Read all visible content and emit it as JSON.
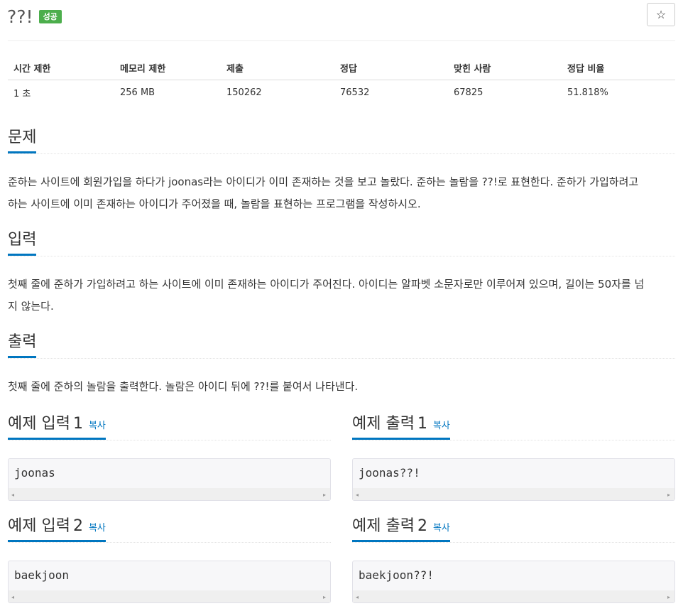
{
  "header": {
    "title": "??!",
    "badge": "성공",
    "star": "☆"
  },
  "info_table": {
    "headers": [
      "시간 제한",
      "메모리 제한",
      "제출",
      "정답",
      "맞힌 사람",
      "정답 비율"
    ],
    "values": [
      "1 초",
      "256 MB",
      "150262",
      "76532",
      "67825",
      "51.818%"
    ]
  },
  "problem": {
    "title": "문제",
    "lines": [
      "준하는 사이트에 회원가입을 하다가 joonas라는 아이디가 이미 존재하는 것을 보고 놀랐다. 준하는 놀람을 ??!로 표현한다. 준하가 가입하려고",
      "하는 사이트에 이미 존재하는 아이디가 주어졌을 때, 놀람을 표현하는 프로그램을 작성하시오."
    ]
  },
  "input": {
    "title": "입력",
    "lines": [
      "첫째 줄에 준하가 가입하려고 하는 사이트에 이미 존재하는 아이디가 주어진다. 아이디는 알파벳 소문자로만 이루어져 있으며, 길이는 50자를 넘",
      "지 않는다."
    ]
  },
  "output": {
    "title": "출력",
    "lines": [
      "첫째 줄에 준하의 놀람을 출력한다. 놀람은 아이디 뒤에 ??!를 붙여서 나타낸다."
    ]
  },
  "samples": [
    {
      "label": "예제 입력",
      "num": "1",
      "copy": "복사",
      "code": "joonas"
    },
    {
      "label": "예제 출력",
      "num": "1",
      "copy": "복사",
      "code": "joonas??!"
    },
    {
      "label": "예제 입력",
      "num": "2",
      "copy": "복사",
      "code": "baekjoon"
    },
    {
      "label": "예제 출력",
      "num": "2",
      "copy": "복사",
      "code": "baekjoon??!"
    }
  ],
  "icons": {
    "scroll_left": "◂",
    "scroll_right": "▸"
  }
}
